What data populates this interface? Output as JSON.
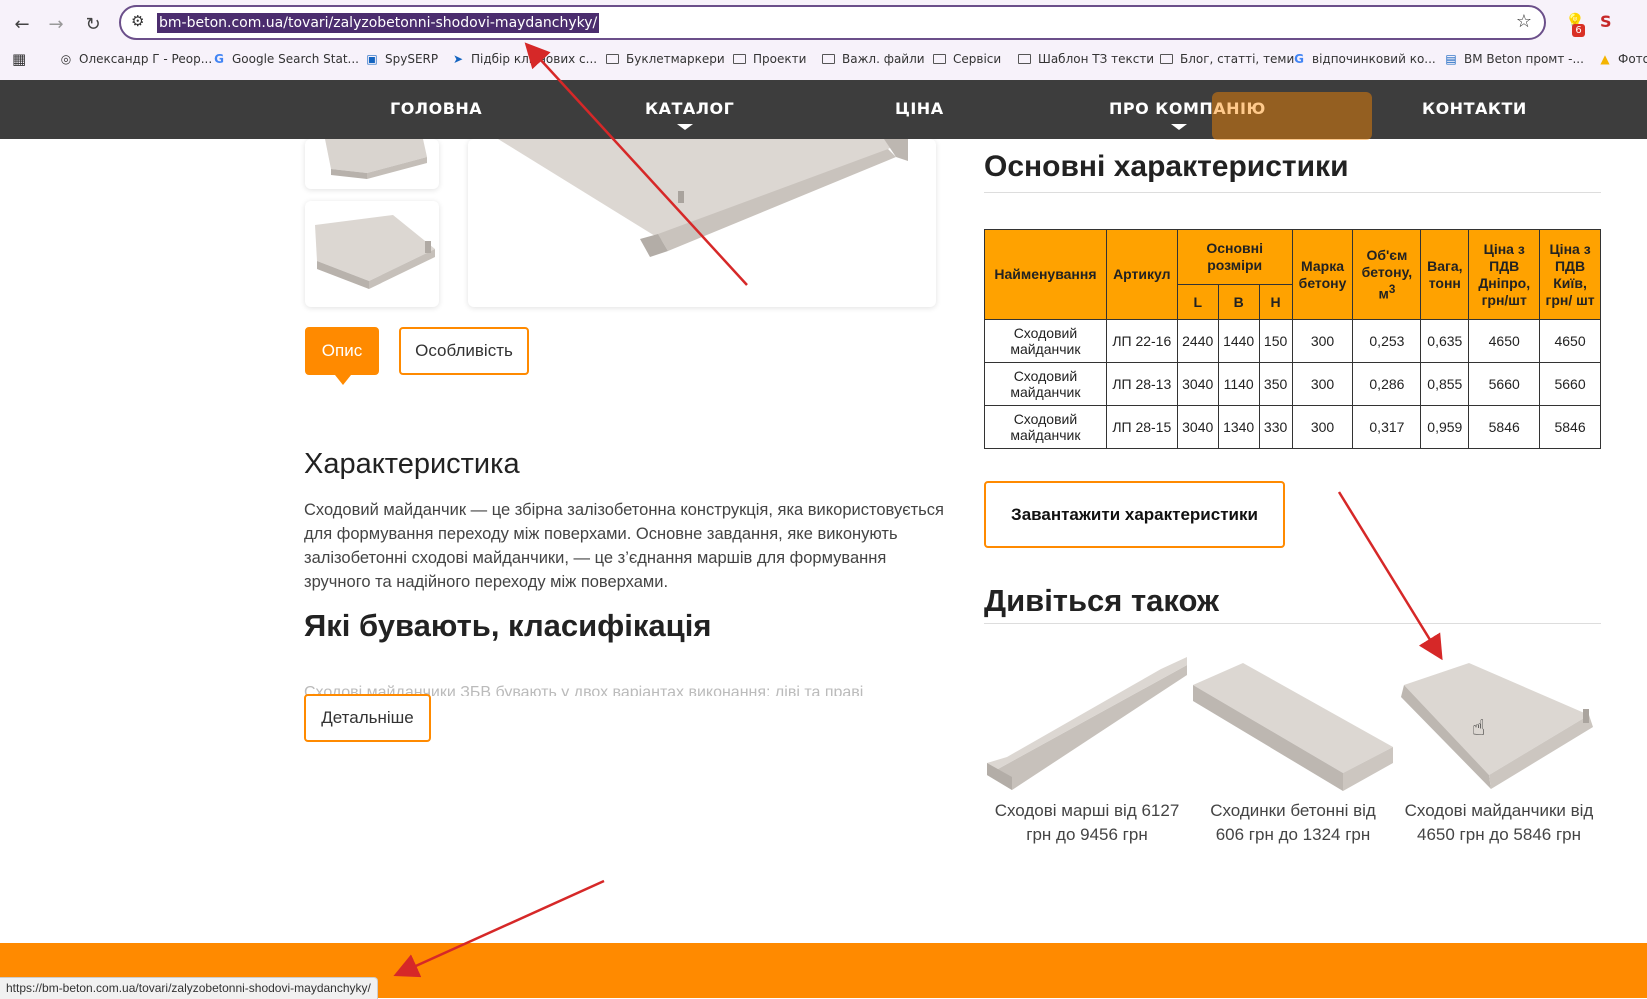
{
  "browser": {
    "url": "bm-beton.com.ua/tovari/zalyzobetonni-shodovi-maydanchyky/",
    "extension_badge": "6",
    "bookmarks": [
      {
        "label": "Олександр Г - Peop...",
        "icon": "contact-icon"
      },
      {
        "label": "Google Search Stat...",
        "icon": "google-icon"
      },
      {
        "label": "SpySERP",
        "icon": "spyserp-icon"
      },
      {
        "label": "Підбір ключових с...",
        "icon": "keyword-tool-icon"
      },
      {
        "label": "Буклетмаркери",
        "icon": "folder-icon"
      },
      {
        "label": "Проекти",
        "icon": "folder-icon"
      },
      {
        "label": "Важл. файли",
        "icon": "folder-icon"
      },
      {
        "label": "Сервіси",
        "icon": "folder-icon"
      },
      {
        "label": "Шаблон ТЗ тексти",
        "icon": "folder-icon"
      },
      {
        "label": "Блог, статті, теми",
        "icon": "folder-icon"
      },
      {
        "label": "відпочинковий ко...",
        "icon": "google-icon"
      },
      {
        "label": "BM Beton промт -...",
        "icon": "doc-icon"
      },
      {
        "label": "Фото",
        "icon": "drive-icon"
      }
    ]
  },
  "site_nav": {
    "items": [
      "ГОЛОВНА",
      "КАТАЛОГ",
      "ЦІНА",
      "ПРО КОМПАНІЮ",
      "КОНТАКТИ"
    ]
  },
  "product": {
    "tabs": {
      "active": "Опис",
      "inactive": "Особливість"
    },
    "characteristics_heading": "Характеристика",
    "description": "Сходовий майданчик — це збірна залізобетонна конструкція, яка використовується для формування переходу між поверхами. Основне завдання, яке виконують залізобетонні сходові майданчики, — це з’єднання маршів для формування зручного та надійного переходу між поверхами.",
    "classification_heading": "Які бувають, класифікація",
    "faded_text": "Сходові майданчики ЗБВ бувають у двох варіантах виконання: ліві та праві",
    "more_button": "Детальніше"
  },
  "specs": {
    "heading": "Основні характеристики",
    "headers": {
      "name": "Найменування",
      "article": "Артикул",
      "dims": "Основні розміри",
      "L": "L",
      "B": "B",
      "H": "H",
      "grade": "Марка бетону",
      "volume": "Об'єм бетону, м",
      "volume_sup": "3",
      "weight": "Вага, тонн",
      "price_dnipro": "Ціна з ПДВ Дніпро, грн/шт",
      "price_kyiv": "Ціна з ПДВ Київ, грн/ шт"
    },
    "rows": [
      {
        "name": "Сходовий майданчик",
        "article": "ЛП 22-16",
        "L": "2440",
        "B": "1440",
        "H": "150",
        "grade": "300",
        "volume": "0,253",
        "weight": "0,635",
        "price_dnipro": "4650",
        "price_kyiv": "4650"
      },
      {
        "name": "Сходовий майданчик",
        "article": "ЛП 28-13",
        "L": "3040",
        "B": "1140",
        "H": "350",
        "grade": "300",
        "volume": "0,286",
        "weight": "0,855",
        "price_dnipro": "5660",
        "price_kyiv": "5660"
      },
      {
        "name": "Сходовий майданчик",
        "article": "ЛП 28-15",
        "L": "3040",
        "B": "1340",
        "H": "330",
        "grade": "300",
        "volume": "0,317",
        "weight": "0,959",
        "price_dnipro": "5846",
        "price_kyiv": "5846"
      }
    ],
    "download_button": "Завантажити характеристики"
  },
  "see_also": {
    "heading": "Дивіться також",
    "cards": [
      {
        "line1": "Сходові марші від 6127",
        "line2": "грн до 9456 грн"
      },
      {
        "line1": "Сходинки бетонні від",
        "line2": "606 грн до 1324 грн"
      },
      {
        "line1": "Сходові майданчики від",
        "line2": "4650 грн до 5846 грн"
      }
    ]
  },
  "status_bar": {
    "url": "https://bm-beton.com.ua/tovari/zalyzobetonni-shodovi-maydanchyky/"
  },
  "colors": {
    "accent": "#ff8a00",
    "table_header": "#ffa200",
    "nav_bg": "#3d3d3d",
    "annotation_arrow": "#d62828"
  }
}
